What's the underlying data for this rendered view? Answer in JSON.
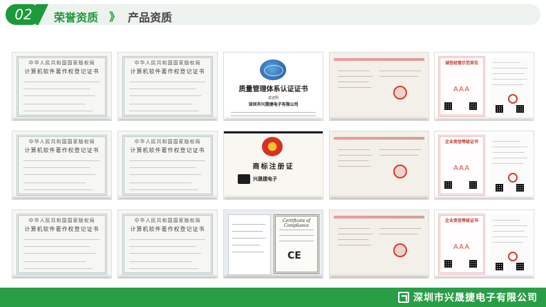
{
  "header": {
    "number": "02",
    "title": "荣誉资质",
    "chevron": "》",
    "subtitle": "产品资质"
  },
  "colors": {
    "brand_green": "#1c9a3a",
    "footer_green": "#2a9d47",
    "seal_red": "#d9392c"
  },
  "certificates": {
    "software": {
      "authority": "中华人民共和国国家版权局",
      "title": "计算机软件著作权登记证书"
    },
    "qms": {
      "title": "质量管理体系认证证书",
      "label": "兹证明",
      "company": "深圳市兴晟捷电子有限公司"
    },
    "trademark": {
      "title": "商标注册证",
      "brand": "兴晟捷电子"
    },
    "ce": {
      "title": "Certificate of Compliance",
      "mark": "CE"
    },
    "credit": {
      "title_a": "诚信经营示范单位",
      "title_b": "企业资信等级证书",
      "title_c": "企业资信等级证书",
      "rating": "AAA"
    }
  },
  "footer": {
    "company": "深圳市兴晟捷电子有限公司"
  }
}
